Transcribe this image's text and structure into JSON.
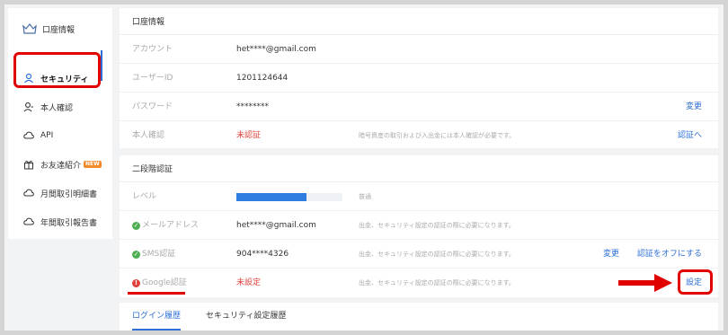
{
  "sidebar": {
    "items": [
      {
        "label": "口座情報",
        "icon": "crown-icon"
      },
      {
        "label": "セキュリティ",
        "icon": "user-icon"
      },
      {
        "label": "本人確認",
        "icon": "user-check-icon"
      },
      {
        "label": "API",
        "icon": "cloud-icon"
      },
      {
        "label": "お友達紹介",
        "icon": "gift-icon",
        "badge": "NEW"
      },
      {
        "label": "月間取引明細書",
        "icon": "cloud-icon"
      },
      {
        "label": "年間取引報告書",
        "icon": "cloud-icon"
      }
    ]
  },
  "account": {
    "title": "口座情報",
    "rows": [
      {
        "label": "アカウント",
        "value": "het****@gmail.com"
      },
      {
        "label": "ユーザーID",
        "value": "1201124644"
      },
      {
        "label": "パスワード",
        "value": "********",
        "action": "変更"
      },
      {
        "label": "本人確認",
        "value": "未認証",
        "note": "暗号資産の取引および入出金には本人確認が必要です。",
        "action": "認証へ"
      }
    ]
  },
  "twofa": {
    "title": "二段階認証",
    "level": {
      "label": "レベル",
      "text": "普通",
      "fill_fraction": 0.66
    },
    "rows": [
      {
        "label": "メールアドレス",
        "value": "het****@gmail.com",
        "note": "出金、セキュリティ設定の認証の際に必要になります。"
      },
      {
        "label": "SMS認証",
        "value": "904****4326",
        "note": "出金、セキュリティ設定の認証の際に必要になります。",
        "action": "変更",
        "action2": "認証をオフにする"
      },
      {
        "label": "Google認証",
        "value": "未設定",
        "note": "出金、セキュリティ設定の認証の際に必要になります。",
        "action": "設定"
      }
    ]
  },
  "tabs": [
    "ログイン履歴",
    "セキュリティ設定履歴"
  ],
  "colors": {
    "accent": "#2e6fd8",
    "alert": "#e0413b",
    "callout": "#e10000",
    "ok": "#4caf50"
  }
}
